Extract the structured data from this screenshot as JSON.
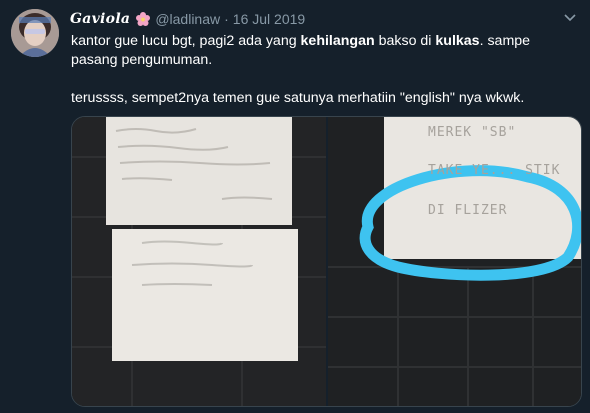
{
  "user": {
    "display_name": "Gaviola",
    "display_emoji": "flower-emoji",
    "handle": "@ladlinaw",
    "separator": "·",
    "date": "16 Jul 2019"
  },
  "tweet": {
    "line1_a": "kantor gue lucu bgt, pagi2 ada yang ",
    "line1_b": "kehilangan",
    "line1_c": " bakso di ",
    "line1_d": "kulkas",
    "line1_e": ". sampe pasang pengumuman.",
    "line2": "terussss, sempet2nya temen gue satunya merhatiin \"english\" nya wkwk."
  },
  "media": {
    "note_right_lines": [
      "MEREK \"SB\"",
      "TAKE YE... STIK",
      "DI FLIZER"
    ],
    "highlight_color": "#3ec3f0"
  },
  "colors": {
    "background": "#15202b",
    "secondary_text": "#8899a6",
    "primary_text": "#ffffff"
  }
}
